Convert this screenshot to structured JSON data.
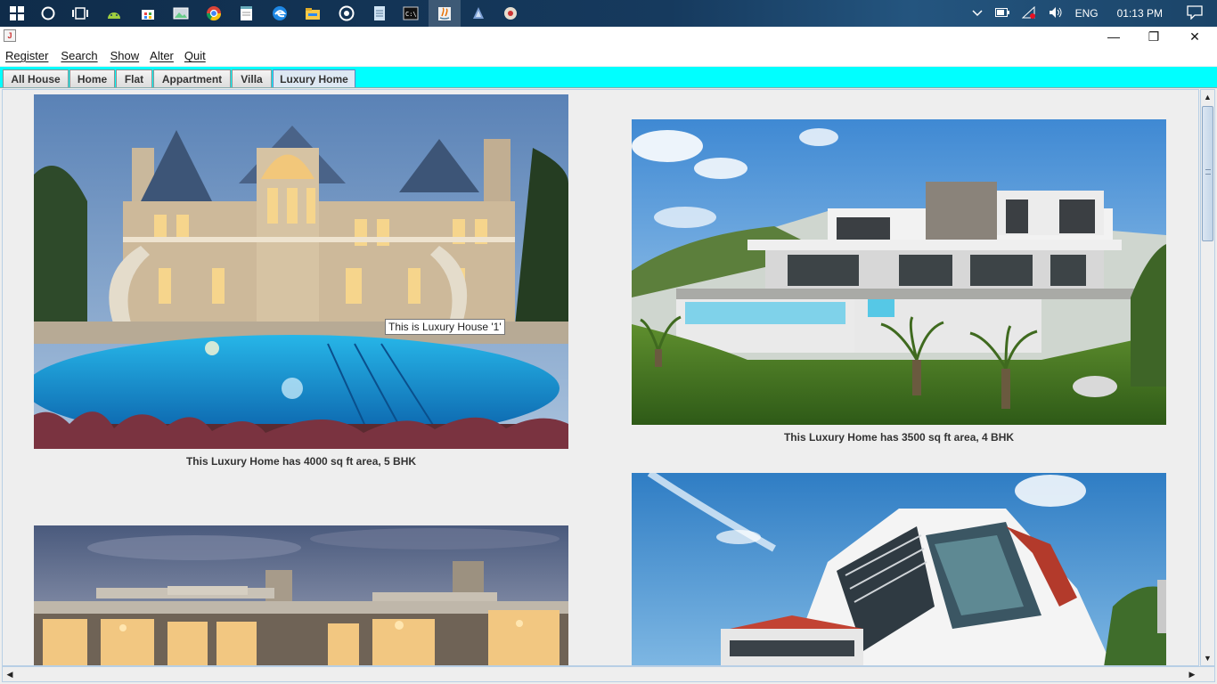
{
  "taskbar": {
    "icons": [
      "windows-start-icon",
      "cortana-icon",
      "task-view-icon",
      "android-studio-icon",
      "store-icon",
      "photos-icon",
      "chrome-icon",
      "notepad-icon",
      "edge-icon",
      "file-explorer-icon",
      "media-icon",
      "notes-icon",
      "cmd-icon",
      "java-icon",
      "netbeans-icon",
      "game-icon"
    ],
    "tray": {
      "language": "ENG",
      "time": "01:13 PM"
    }
  },
  "window": {
    "controls": {
      "minimize": "—",
      "maximize": "❐",
      "close": "✕"
    }
  },
  "menubar": {
    "items": [
      "Register",
      "Search",
      "Show",
      "Alter",
      "Quit"
    ]
  },
  "tabs": {
    "items": [
      "All House",
      "Home",
      "Flat",
      "Appartment",
      "Villa",
      "Luxury Home"
    ],
    "selected": "Luxury Home"
  },
  "houses": [
    {
      "caption": "This Luxury Home has 4000 sq ft area, 5 BHK"
    },
    {
      "caption": "This Luxury Home has 3500 sq ft area, 4 BHK"
    },
    {
      "caption": ""
    },
    {
      "caption": ""
    }
  ],
  "tooltip": "This is Luxury House '1'",
  "colors": {
    "tabstrip": "#00ffff",
    "window_bg": "#eeeeee",
    "tab_selected": "#dde8f3"
  }
}
